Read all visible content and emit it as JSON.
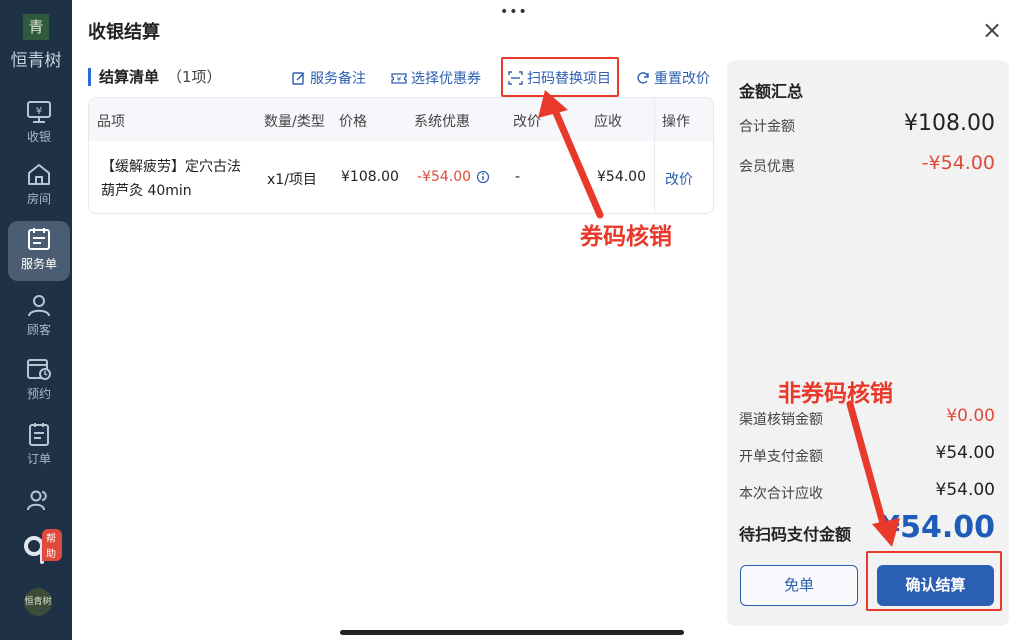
{
  "app": {
    "logo_mark": "青",
    "logo_text": "恒青树",
    "bottom_logo": "恒青树"
  },
  "sidebar": {
    "items": [
      {
        "label": "收银",
        "icon": "cashier-monitor-icon"
      },
      {
        "label": "房间",
        "icon": "home-icon"
      },
      {
        "label": "服务单",
        "icon": "service-order-icon",
        "active": true
      },
      {
        "label": "顾客",
        "icon": "user-icon"
      },
      {
        "label": "预约",
        "icon": "calendar-clock-icon"
      },
      {
        "label": "订单",
        "icon": "order-list-icon"
      },
      {
        "label": "",
        "icon": "users-icon"
      }
    ],
    "help_badge": "帮助"
  },
  "dialog": {
    "title": "收银结算",
    "close_symbol": "×",
    "top_dots": "•••"
  },
  "list": {
    "title": "结算清单",
    "count": "（1项）",
    "actions": {
      "note": "服务备注",
      "coupon": "选择优惠券",
      "scan": "扫码替换项目",
      "reset": "重置改价"
    },
    "columns": [
      "品项",
      "数量/类型",
      "价格",
      "系统优惠",
      "改价",
      "应收",
      "操作"
    ],
    "rows": [
      {
        "item_line1": "【缓解疲劳】定穴古法",
        "item_line2": "葫芦灸 40min",
        "qty": "x1/项目",
        "price": "¥108.00",
        "discount": "-¥54.00",
        "adjust": "-",
        "receivable": "¥54.00",
        "action": "改价"
      }
    ]
  },
  "annotations": {
    "coupon_verify": "券码核销",
    "non_coupon_verify": "非券码核销"
  },
  "summary": {
    "title": "金额汇总",
    "total_label": "合计金额",
    "total_value": "¥108.00",
    "member_label": "会员优惠",
    "member_value": "-¥54.00",
    "channel_label": "渠道核销金额",
    "channel_value": "¥0.00",
    "open_pay_label": "开单支付金额",
    "open_pay_value": "¥54.00",
    "current_label": "本次合计应收",
    "current_value": "¥54.00",
    "pending_label": "待扫码支付金额",
    "pending_value": "¥54.00",
    "free_button": "免单",
    "confirm_button": "确认结算"
  },
  "colors": {
    "sidebar_bg": "#1f3147",
    "accent_blue": "#2a5fb4",
    "discount_red": "#e04a3c",
    "annotation_red": "#e8392b"
  }
}
